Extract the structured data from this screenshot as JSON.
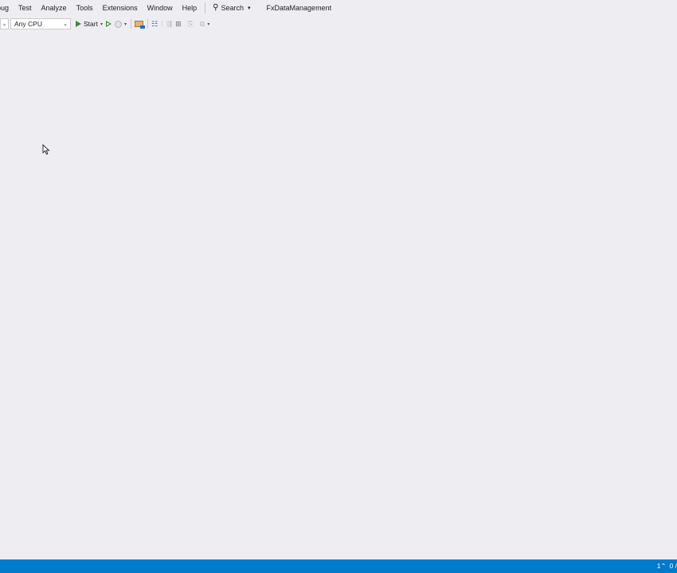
{
  "menu": {
    "items": [
      "bug",
      "Test",
      "Analyze",
      "Tools",
      "Extensions",
      "Window",
      "Help"
    ],
    "search_label": "Search",
    "solution_name": "FxDataManagement"
  },
  "toolbar": {
    "config_combo_arrow": "⌄",
    "platform_value": "Any CPU",
    "start_label": "Start",
    "icons": [
      "start-icon",
      "start-without-debugging-icon",
      "attach-icon",
      "browser-link-icon",
      "breakpoint-icon",
      "step-icon",
      "hot-reload-icon",
      "bookmark-icon",
      "comment-icon"
    ]
  },
  "statusbar": {
    "indicator_primary": "1",
    "indicator_secondary": "0 /"
  },
  "colors": {
    "background": "#eeeef2",
    "statusbar": "#007acc",
    "play_green": "#388a34",
    "accent_blue": "#1e6fd1"
  }
}
